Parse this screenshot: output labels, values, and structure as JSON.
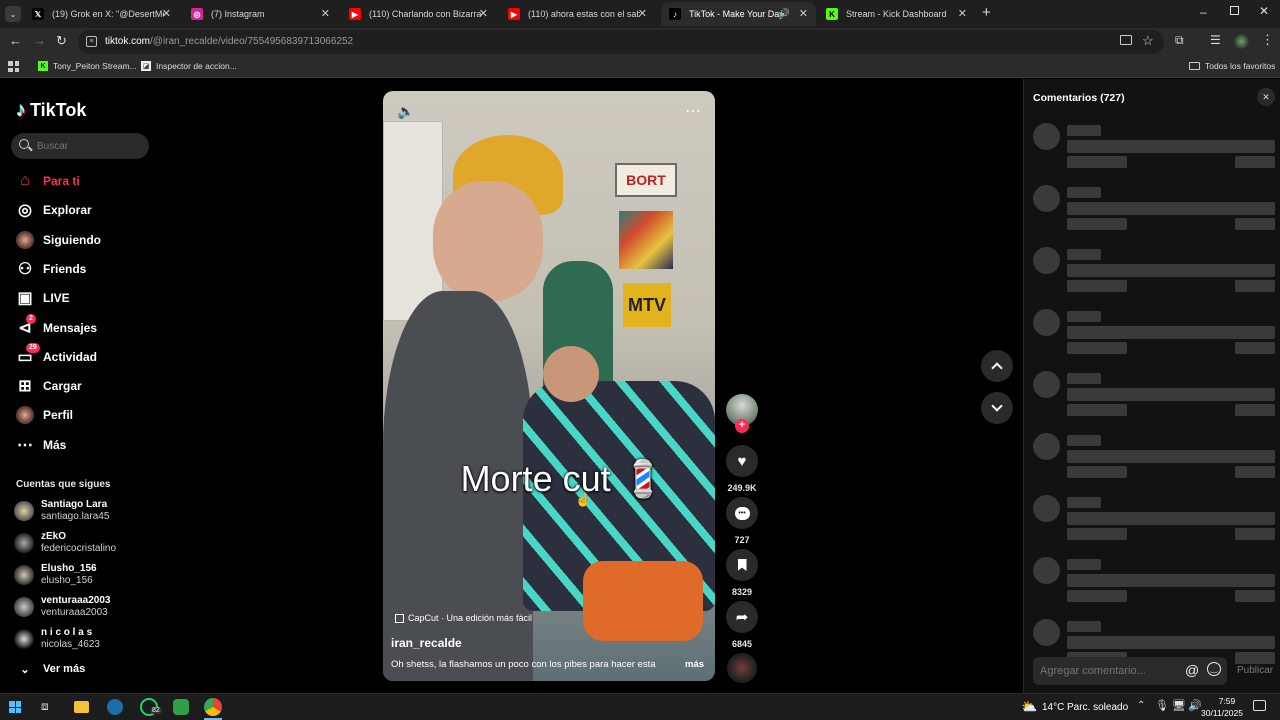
{
  "browser": {
    "tabs": [
      {
        "title": "(19) Grok en X: \"@DesertMende",
        "icon": "x-logo-icon",
        "fav_bg": "#000000",
        "fav_glyph": "𝕏"
      },
      {
        "title": "(7) Instagram",
        "icon": "instagram-icon",
        "fav_bg": "#d6249f",
        "fav_glyph": "◎"
      },
      {
        "title": "(110) Charlando con Bizarrap y",
        "icon": "youtube-icon",
        "fav_bg": "#ff0000",
        "fav_glyph": "▶"
      },
      {
        "title": "(110) ahora estas con el sabien",
        "icon": "youtube-icon",
        "fav_bg": "#ff0000",
        "fav_glyph": "▶"
      },
      {
        "title": "TikTok - Make Your Day",
        "icon": "tiktok-icon",
        "fav_bg": "#000000",
        "fav_glyph": "♪"
      },
      {
        "title": "Stream - Kick Dashboard",
        "icon": "kick-icon",
        "fav_bg": "#53fc18",
        "fav_glyph": "K"
      }
    ],
    "url_host": "tiktok.com",
    "url_path": "/@iran_recalde/video/7554956839713066252",
    "bookmarks": [
      {
        "label": "Tony_Peiton Stream..."
      },
      {
        "label": "Inspector de accion..."
      }
    ],
    "all_bookmarks_label": "Todos los favoritos"
  },
  "sidebar": {
    "logo": "TikTok",
    "search_placeholder": "Buscar",
    "nav": [
      {
        "label": "Para ti",
        "icon": "home-icon",
        "active": true
      },
      {
        "label": "Explorar",
        "icon": "compass-icon"
      },
      {
        "label": "Siguiendo",
        "icon": "following-avatar-icon"
      },
      {
        "label": "Friends",
        "icon": "friends-icon"
      },
      {
        "label": "LIVE",
        "icon": "live-icon"
      },
      {
        "label": "Mensajes",
        "icon": "messages-icon",
        "badge": "2"
      },
      {
        "label": "Actividad",
        "icon": "activity-icon",
        "badge": "29"
      },
      {
        "label": "Cargar",
        "icon": "upload-icon"
      },
      {
        "label": "Perfil",
        "icon": "profile-icon"
      },
      {
        "label": "Más",
        "icon": "more-icon"
      }
    ],
    "following_title": "Cuentas que sigues",
    "accounts": [
      {
        "name": "Santiago Lara",
        "handle": "santiago.lara45"
      },
      {
        "name": "zEkO",
        "handle": "federicocristalino"
      },
      {
        "name": "Elusho_156",
        "handle": "elusho_156"
      },
      {
        "name": "venturaaa2003",
        "handle": "venturaaa2003"
      },
      {
        "name": "n i c o l a s",
        "handle": "nicolas_4623"
      }
    ],
    "see_more": "Ver más"
  },
  "video": {
    "overlay_text": "Morte cut 💈",
    "capcut_label": "CapCut · Una edición más fácil",
    "author": "iran_recalde",
    "caption": "Oh shetss, la flashamos un poco con los pibes para hacer esta",
    "more_label": "más",
    "likes": "249.9K",
    "comments": "727",
    "saves": "8329",
    "shares": "6845"
  },
  "comments_panel": {
    "title": "Comentarios (727)",
    "input_placeholder": "Agregar comentario...",
    "publish_label": "Publicar"
  },
  "taskbar": {
    "weather_temp": "14°C",
    "weather_desc": "Parc. soleado",
    "time": "7:59",
    "date": "30/11/2025",
    "whatsapp_badge": "82"
  }
}
